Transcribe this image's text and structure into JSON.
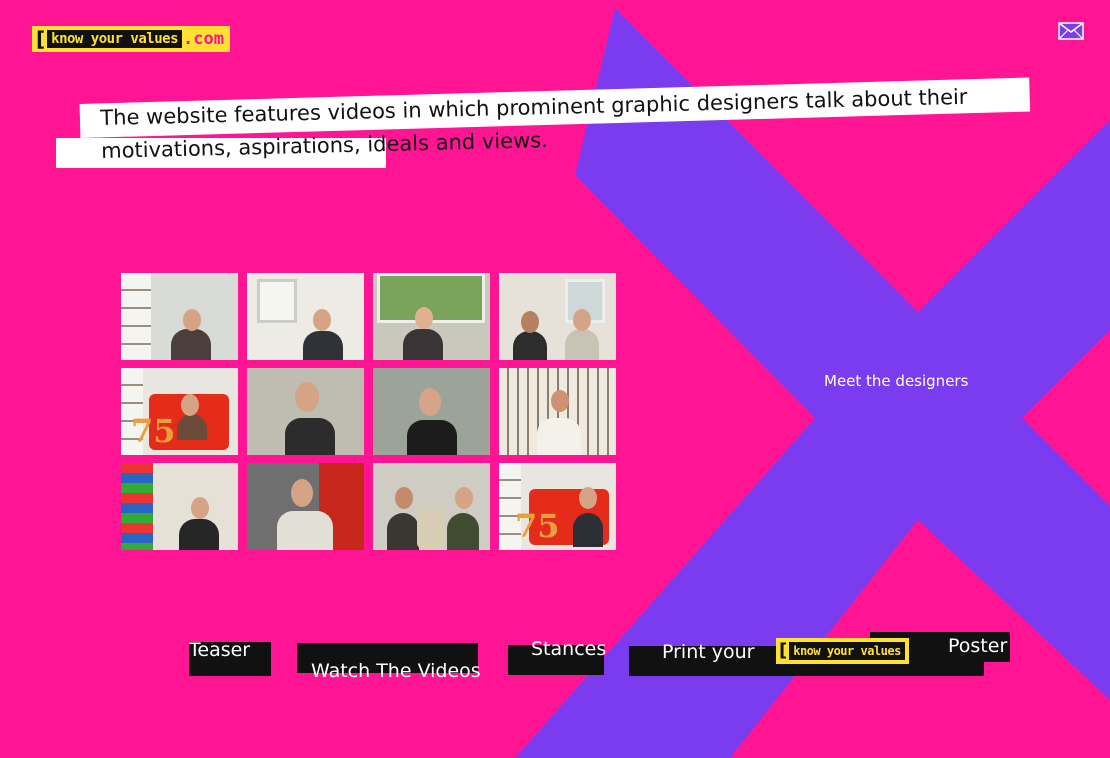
{
  "logo": {
    "bracket": "[",
    "tag": "know your values",
    "tld": ".com"
  },
  "header": {
    "mail_icon": "envelope-icon"
  },
  "intro": {
    "line1": "The website features videos in which prominent graphic designers talk about their",
    "line2": "motivations, aspirations, ideals and views."
  },
  "designers_link": "Meet the designers",
  "nav": {
    "teaser": "Teaser",
    "watch": "Watch The Videos",
    "stances": "Stances",
    "print_prefix": "Print your",
    "print_logo": "know your values",
    "print_suffix": "Poster"
  },
  "colors": {
    "background": "#ff1493",
    "x_shape": "#7b3cf0",
    "accent": "#ffe033"
  },
  "thumbnails": [
    {
      "name": "designer-1"
    },
    {
      "name": "designer-2"
    },
    {
      "name": "designer-3"
    },
    {
      "name": "designer-4"
    },
    {
      "name": "designer-5"
    },
    {
      "name": "designer-6"
    },
    {
      "name": "designer-7"
    },
    {
      "name": "designer-8"
    },
    {
      "name": "designer-9"
    },
    {
      "name": "designer-10"
    },
    {
      "name": "designer-11"
    },
    {
      "name": "designer-12"
    }
  ]
}
